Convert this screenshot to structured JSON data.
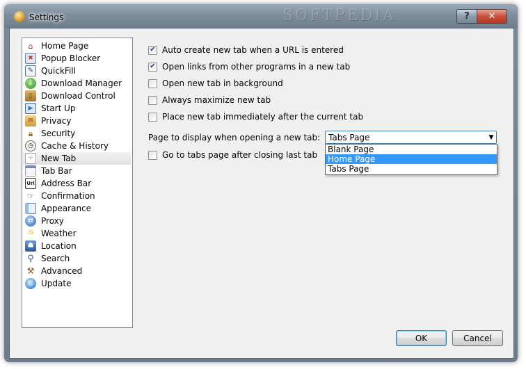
{
  "window": {
    "title": "Settings",
    "watermark": "SOFTPEDIA"
  },
  "sidebar": {
    "selected_index": 9,
    "items": [
      {
        "label": "Home Page",
        "icon": "home-icon"
      },
      {
        "label": "Popup Blocker",
        "icon": "popup-blocker-icon"
      },
      {
        "label": "QuickFill",
        "icon": "quickfill-icon"
      },
      {
        "label": "Download Manager",
        "icon": "download-manager-icon"
      },
      {
        "label": "Download Control",
        "icon": "download-control-icon"
      },
      {
        "label": "Start Up",
        "icon": "startup-icon"
      },
      {
        "label": "Privacy",
        "icon": "privacy-icon"
      },
      {
        "label": "Security",
        "icon": "lock-icon"
      },
      {
        "label": "Cache & History",
        "icon": "clock-icon"
      },
      {
        "label": "New Tab",
        "icon": "new-tab-icon"
      },
      {
        "label": "Tab Bar",
        "icon": "tab-bar-icon"
      },
      {
        "label": "Address Bar",
        "icon": "address-bar-icon"
      },
      {
        "label": "Confirmation",
        "icon": "pointing-hand-icon"
      },
      {
        "label": "Appearance",
        "icon": "appearance-icon"
      },
      {
        "label": "Proxy",
        "icon": "proxy-icon"
      },
      {
        "label": "Weather",
        "icon": "weather-icon"
      },
      {
        "label": "Location",
        "icon": "location-icon"
      },
      {
        "label": "Search",
        "icon": "search-icon"
      },
      {
        "label": "Advanced",
        "icon": "tools-icon"
      },
      {
        "label": "Update",
        "icon": "globe-icon"
      }
    ]
  },
  "options": {
    "auto_create": {
      "label": "Auto create new tab when a URL is entered",
      "checked": true
    },
    "open_links": {
      "label": "Open links from other programs in a new tab",
      "checked": true
    },
    "background": {
      "label": "Open new tab in background",
      "checked": false
    },
    "maximize": {
      "label": "Always maximize new tab",
      "checked": false
    },
    "place_after": {
      "label": "Place new tab immediately after the current tab",
      "checked": false
    },
    "go_to_tabs": {
      "label": "Go to tabs page after closing last tab",
      "checked": false
    }
  },
  "page_display": {
    "label": "Page to display when opening a new tab:",
    "selected": "Tabs Page",
    "highlighted": "Home Page",
    "options": [
      "Blank Page",
      "Home Page",
      "Tabs Page"
    ]
  },
  "buttons": {
    "ok": "OK",
    "cancel": "Cancel"
  },
  "colors": {
    "selection": "#3399ff",
    "accent": "#3c7fb1"
  }
}
